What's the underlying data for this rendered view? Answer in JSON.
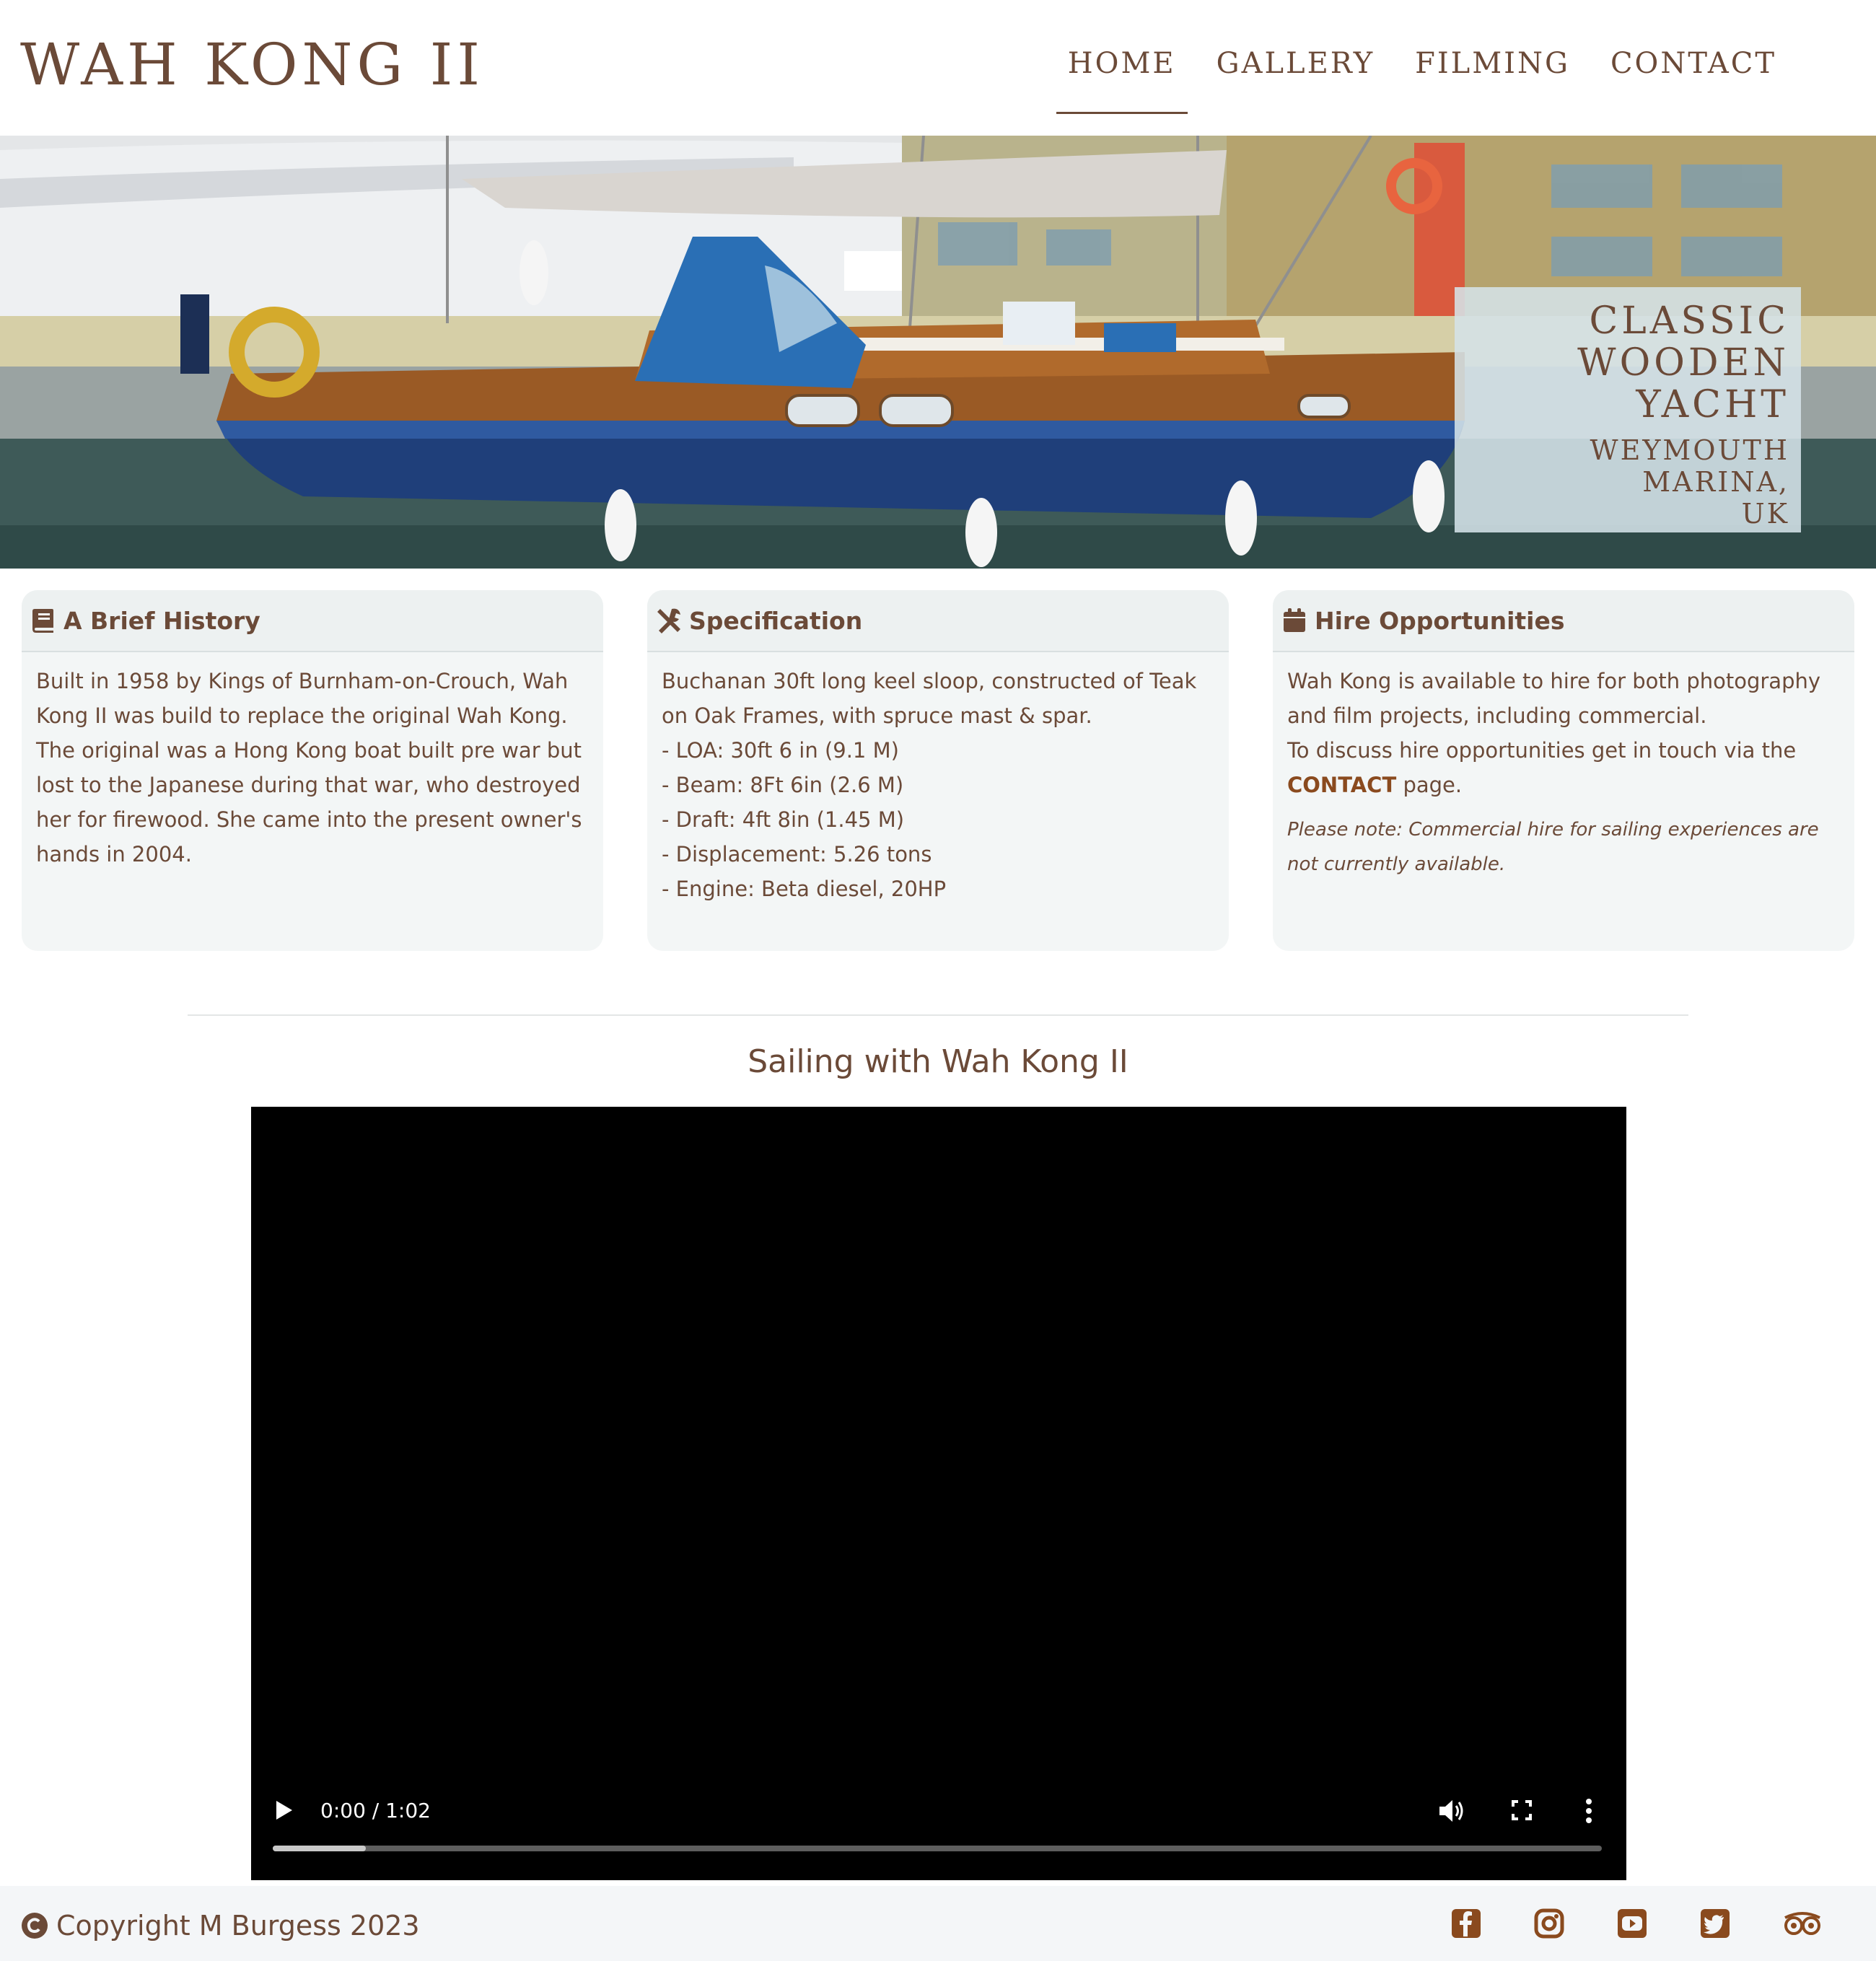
{
  "header": {
    "site_title": "WAH KONG II",
    "nav": [
      {
        "label": "HOME",
        "active": true
      },
      {
        "label": "GALLERY",
        "active": false
      },
      {
        "label": "FILMING",
        "active": false
      },
      {
        "label": "CONTACT",
        "active": false
      }
    ]
  },
  "hero": {
    "title_lines": [
      "CLASSIC",
      "WOODEN",
      "YACHT"
    ],
    "subtitle_lines": [
      "WEYMOUTH MARINA,",
      "UK"
    ]
  },
  "cards": {
    "history": {
      "icon": "book-icon",
      "title": "A Brief History",
      "body": "Built in 1958 by Kings of Burnham-on-Crouch, Wah Kong II was build to replace the original Wah Kong. The original was a Hong Kong boat built pre war but lost to the Japanese during that war, who destroyed her for firewood. She came into the present owner's hands in 2004."
    },
    "spec": {
      "icon": "tools-icon",
      "title": "Specification",
      "intro": "Buchanan 30ft long keel sloop, constructed of Teak on Oak Frames, with spruce mast & spar.",
      "items": [
        "- LOA: 30ft 6 in (9.1 M)",
        "- Beam: 8Ft 6in (2.6 M)",
        "- Draft: 4ft 8in (1.45 M)",
        "- Displacement: 5.26 tons",
        "- Engine: Beta diesel, 20HP"
      ]
    },
    "hire": {
      "icon": "calendar-icon",
      "title": "Hire Opportunities",
      "line1": "Wah Kong is available to hire for both photography and film projects, including commercial.",
      "line2_pre": "To discuss hire opportunities get in touch via the",
      "contact_link": "CONTACT",
      "line2_post": "page.",
      "note": "Please note: Commercial hire for sailing experiences are not currently available."
    }
  },
  "video": {
    "heading": "Sailing with Wah Kong II",
    "time": "0:00 / 1:02",
    "buffered_fraction": 0.07
  },
  "footer": {
    "copyright": "Copyright M Burgess 2023",
    "social_icons": [
      "facebook-icon",
      "instagram-icon",
      "youtube-icon",
      "twitter-icon",
      "tripadvisor-icon"
    ]
  },
  "colors": {
    "text": "#6b4a38",
    "link": "#8a4a1e",
    "card_bg": "#f3f6f6",
    "hull_blue": "#1f3f7a",
    "teak": "#9a5a25"
  }
}
